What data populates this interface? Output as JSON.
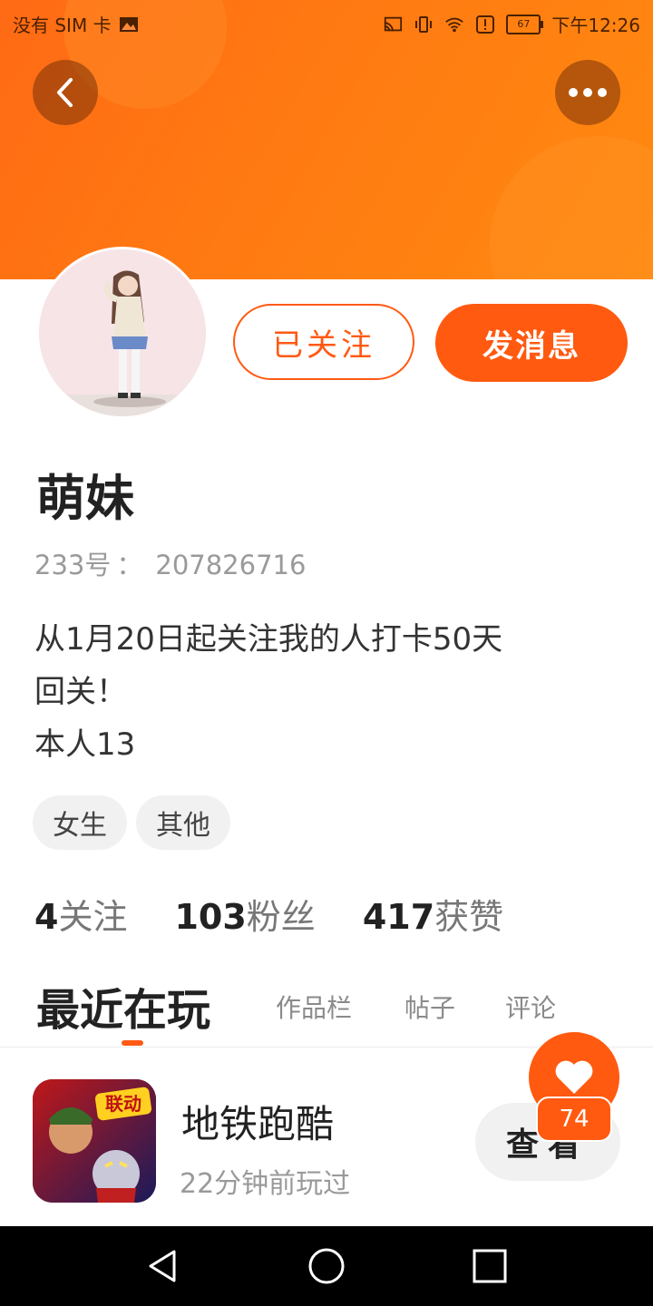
{
  "status_bar": {
    "carrier": "没有 SIM 卡",
    "battery": "67",
    "time": "下午12:26",
    "icons": [
      "image-icon",
      "cast-icon",
      "vibrate-icon",
      "wifi-icon",
      "alert-icon",
      "battery-icon"
    ]
  },
  "header": {
    "back_icon": "chevron-left-icon",
    "more_icon": "more-dots-icon"
  },
  "profile": {
    "follow_label": "已关注",
    "message_label": "发消息",
    "name": "萌妹",
    "id_label": "233号",
    "id_sep": "：",
    "id_value": "207826716",
    "bio_line1": "从1月20日起关注我的人打卡50天",
    "bio_line2": "回关！",
    "bio_line3": "本人13",
    "tags": [
      "女生",
      "其他"
    ]
  },
  "stats": {
    "following_num": "4",
    "following_label": "关注",
    "fans_num": "103",
    "fans_label": "粉丝",
    "likes_num": "417",
    "likes_label": "获赞"
  },
  "tabs": {
    "active": "最近在玩",
    "tab2": "作品栏",
    "tab3": "帖子",
    "tab4": "评论"
  },
  "recent_game": {
    "title": "地铁跑酷",
    "subtitle": "22分钟前玩过",
    "view_label": "查看",
    "icon_badge": "联动"
  },
  "like_fab": {
    "count": "74"
  },
  "colors": {
    "accent": "#ff5a10",
    "banner": "#ff7a12",
    "tag_bg": "#f1f1f1"
  }
}
